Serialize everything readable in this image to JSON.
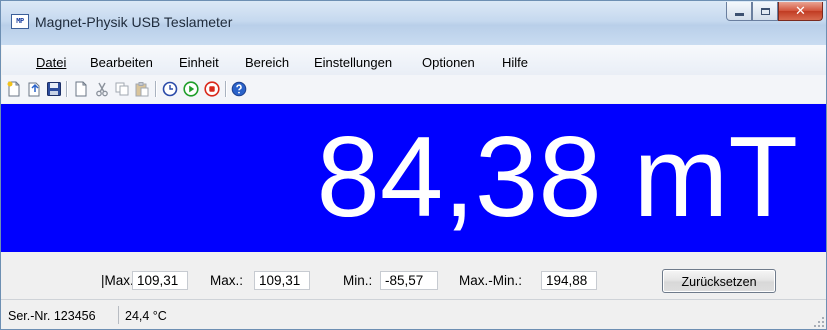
{
  "window": {
    "title": "Magnet-Physik USB Teslameter",
    "app_icon_text": "MP",
    "controls": {
      "minimize": "minimize",
      "maximize": "maximize",
      "close": "✕"
    }
  },
  "menu": {
    "items": [
      {
        "label": "Datei"
      },
      {
        "label": "Bearbeiten"
      },
      {
        "label": "Einheit"
      },
      {
        "label": "Bereich"
      },
      {
        "label": "Einstellungen"
      },
      {
        "label": "Optionen"
      },
      {
        "label": "Hilfe"
      }
    ]
  },
  "toolbar": {
    "icons": [
      "new-icon",
      "open-icon",
      "save-icon",
      "page-icon",
      "cut-icon",
      "copy-icon",
      "paste-icon",
      "timer-icon",
      "play-icon",
      "stop-icon",
      "help-icon"
    ],
    "accent_colors": {
      "save": "#2c4c9c",
      "play": "#1f9e2a",
      "stop": "#d9281b",
      "help": "#2a62c9",
      "timer": "#2a4aa8"
    }
  },
  "display": {
    "value": "84,38",
    "unit": "mT",
    "reading": "84,38 mT",
    "background_color": "#0000ff",
    "text_color": "#ffffff"
  },
  "stats": {
    "abs_max_label": "|Max.|:",
    "abs_max_value": "109,31",
    "max_label": "Max.:",
    "max_value": "109,31",
    "min_label": "Min.:",
    "min_value": "-85,57",
    "range_label": "Max.-Min.:",
    "range_value": "194,88",
    "reset_label": "Zurücksetzen"
  },
  "status": {
    "serial": "Ser.-Nr. 123456",
    "temperature": "24,4 °C"
  }
}
